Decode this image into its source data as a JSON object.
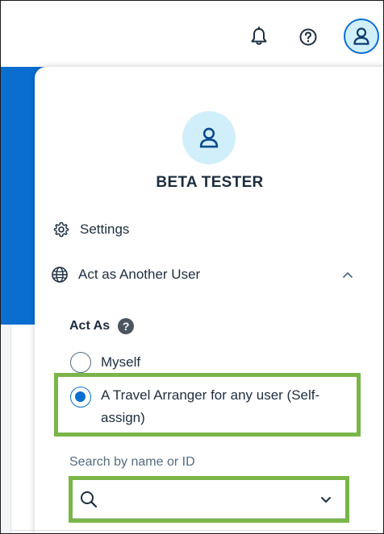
{
  "header": {
    "icons": [
      "bell-icon",
      "help-icon",
      "user-icon"
    ]
  },
  "profile": {
    "name": "BETA TESTER",
    "avatar_icon": "user-icon"
  },
  "menu": {
    "settings_label": "Settings",
    "act_as_another_user_label": "Act as Another User"
  },
  "act_as": {
    "heading": "Act As",
    "help_glyph": "?",
    "options": [
      {
        "label": "Myself",
        "selected": false
      },
      {
        "label": "A Travel Arranger for any user (Self-assign)",
        "selected": true
      }
    ]
  },
  "search": {
    "caption": "Search by name or ID",
    "value": "",
    "placeholder": ""
  },
  "colors": {
    "accent": "#0a6ed1",
    "avatar_bg": "#d1effa",
    "highlight": "#7ab648",
    "text": "#1d2d3e"
  }
}
